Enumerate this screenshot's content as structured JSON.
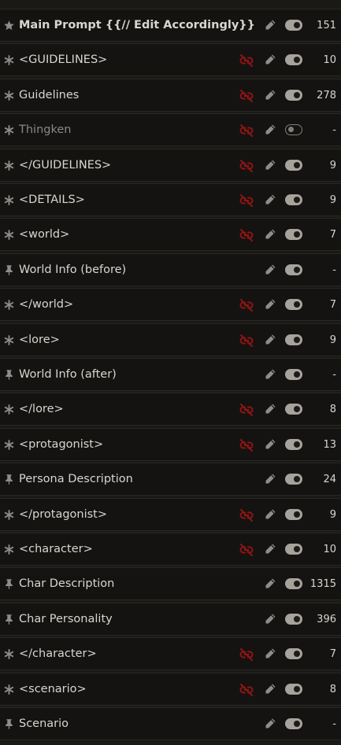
{
  "colors": {
    "unlink": "#8e1414",
    "muted_icon": "#8f8d88",
    "text": "#d8d6d0"
  },
  "rows": [
    {
      "icon": "star-icon",
      "name": "Main Prompt {{// Edit Accordingly}}",
      "bold": true,
      "unlinked": false,
      "enabled": true,
      "tokens": "151"
    },
    {
      "icon": "asterisk-icon",
      "name": "<GUIDELINES>",
      "unlinked": true,
      "enabled": true,
      "tokens": "10"
    },
    {
      "icon": "asterisk-icon",
      "name": "Guidelines",
      "unlinked": true,
      "enabled": true,
      "tokens": "278"
    },
    {
      "icon": "asterisk-icon",
      "name": "Thingken",
      "dim": true,
      "unlinked": true,
      "enabled": false,
      "tokens": "-"
    },
    {
      "icon": "asterisk-icon",
      "name": "</GUIDELINES>",
      "unlinked": true,
      "enabled": true,
      "tokens": "9"
    },
    {
      "icon": "asterisk-icon",
      "name": "<DETAILS>",
      "unlinked": true,
      "enabled": true,
      "tokens": "9"
    },
    {
      "icon": "asterisk-icon",
      "name": "<world>",
      "unlinked": true,
      "enabled": true,
      "tokens": "7"
    },
    {
      "icon": "pin-icon",
      "name": "World Info (before)",
      "unlinked": false,
      "enabled": true,
      "tokens": "-"
    },
    {
      "icon": "asterisk-icon",
      "name": "</world>",
      "unlinked": true,
      "enabled": true,
      "tokens": "7"
    },
    {
      "icon": "asterisk-icon",
      "name": "<lore>",
      "unlinked": true,
      "enabled": true,
      "tokens": "9"
    },
    {
      "icon": "pin-icon",
      "name": "World Info (after)",
      "unlinked": false,
      "enabled": true,
      "tokens": "-"
    },
    {
      "icon": "asterisk-icon",
      "name": "</lore>",
      "unlinked": true,
      "enabled": true,
      "tokens": "8"
    },
    {
      "icon": "asterisk-icon",
      "name": "<protagonist>",
      "unlinked": true,
      "enabled": true,
      "tokens": "13"
    },
    {
      "icon": "pin-icon",
      "name": "Persona Description",
      "unlinked": false,
      "enabled": true,
      "tokens": "24"
    },
    {
      "icon": "asterisk-icon",
      "name": "</protagonist>",
      "unlinked": true,
      "enabled": true,
      "tokens": "9"
    },
    {
      "icon": "asterisk-icon",
      "name": "<character>",
      "unlinked": true,
      "enabled": true,
      "tokens": "10"
    },
    {
      "icon": "pin-icon",
      "name": "Char Description",
      "unlinked": false,
      "enabled": true,
      "tokens": "1315"
    },
    {
      "icon": "pin-icon",
      "name": "Char Personality",
      "unlinked": false,
      "enabled": true,
      "tokens": "396"
    },
    {
      "icon": "asterisk-icon",
      "name": "</character>",
      "unlinked": true,
      "enabled": true,
      "tokens": "7"
    },
    {
      "icon": "asterisk-icon",
      "name": "<scenario>",
      "unlinked": true,
      "enabled": true,
      "tokens": "8"
    },
    {
      "icon": "pin-icon",
      "name": "Scenario",
      "unlinked": false,
      "enabled": true,
      "tokens": "-"
    }
  ]
}
